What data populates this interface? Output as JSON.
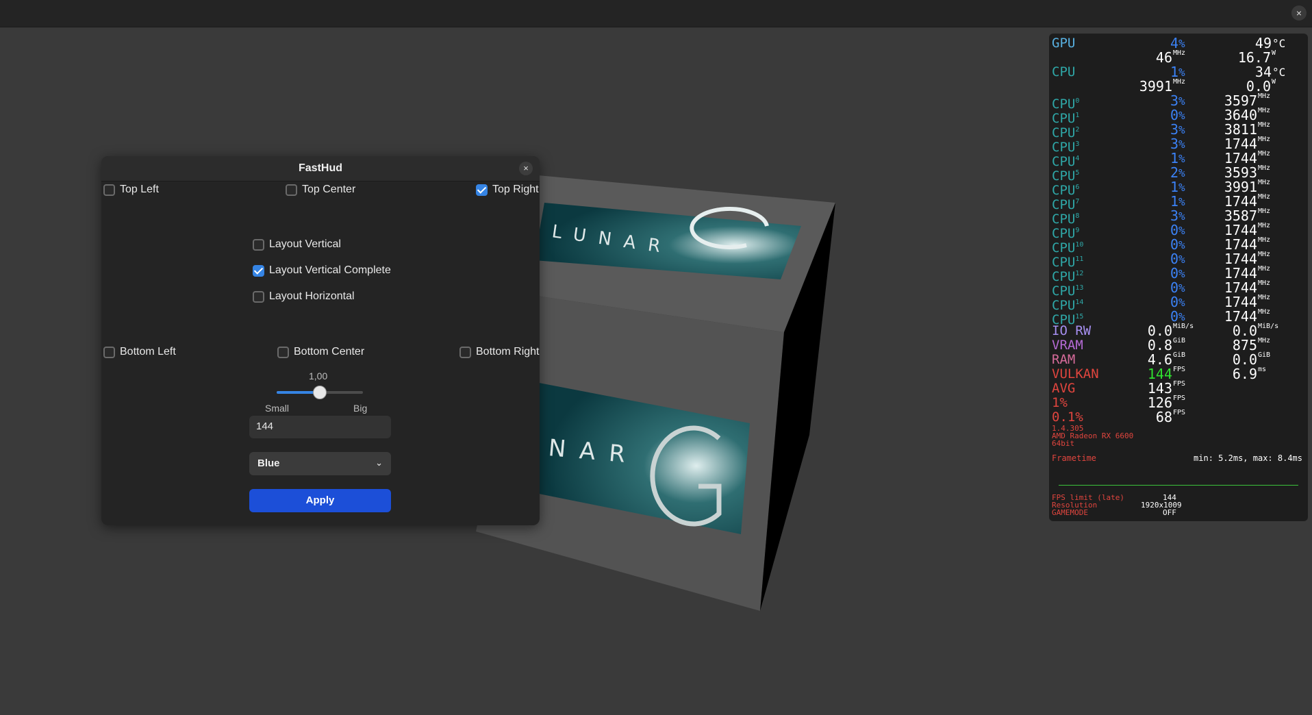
{
  "window": {
    "close_icon": "×"
  },
  "dialog": {
    "title": "FastHud",
    "close_icon": "×",
    "positions": {
      "top_left": {
        "label": "Top Left",
        "checked": false
      },
      "top_center": {
        "label": "Top Center",
        "checked": false
      },
      "top_right": {
        "label": "Top Right",
        "checked": true
      },
      "bottom_left": {
        "label": "Bottom Left",
        "checked": false
      },
      "bottom_center": {
        "label": "Bottom Center",
        "checked": false
      },
      "bottom_right": {
        "label": "Bottom Right",
        "checked": false
      }
    },
    "layouts": {
      "vertical": {
        "label": "Layout Vertical",
        "checked": false
      },
      "vertical_complete": {
        "label": "Layout Vertical Complete",
        "checked": true
      },
      "horizontal": {
        "label": "Layout Horizontal",
        "checked": false
      }
    },
    "scale": {
      "value_text": "1,00",
      "min_label": "Small",
      "max_label": "Big",
      "fraction": 0.5
    },
    "fps_limit_value": "144",
    "color_select": {
      "value": "Blue",
      "chevron_icon": "chevron-down-icon"
    },
    "apply_label": "Apply"
  },
  "hud": {
    "colors": {
      "gpu": "#58b0e0",
      "cpu": "#2fa7a7",
      "load": "#3b82f6",
      "io": "#a68ff0",
      "vram": "#b46ad4",
      "ram": "#d66b9a",
      "vulkan": "#e0453e",
      "fps_green": "#2fe12f",
      "info": "#e0453e"
    },
    "gpu": {
      "label": "GPU",
      "load": "4",
      "load_unit": "%",
      "temp": "49",
      "temp_unit": "°C",
      "clock": "46",
      "clock_unit": "MHz",
      "power": "16.7",
      "power_unit": "W"
    },
    "cpu": {
      "label": "CPU",
      "load": "1",
      "load_unit": "%",
      "temp": "34",
      "temp_unit": "°C",
      "clock": "3991",
      "clock_unit": "MHz",
      "power": "0.0",
      "power_unit": "W"
    },
    "cores": [
      {
        "idx": "0",
        "load": "3",
        "freq": "3597"
      },
      {
        "idx": "1",
        "load": "0",
        "freq": "3640"
      },
      {
        "idx": "2",
        "load": "3",
        "freq": "3811"
      },
      {
        "idx": "3",
        "load": "3",
        "freq": "1744"
      },
      {
        "idx": "4",
        "load": "1",
        "freq": "1744"
      },
      {
        "idx": "5",
        "load": "2",
        "freq": "3593"
      },
      {
        "idx": "6",
        "load": "1",
        "freq": "3991"
      },
      {
        "idx": "7",
        "load": "1",
        "freq": "1744"
      },
      {
        "idx": "8",
        "load": "3",
        "freq": "3587"
      },
      {
        "idx": "9",
        "load": "0",
        "freq": "1744"
      },
      {
        "idx": "10",
        "load": "0",
        "freq": "1744"
      },
      {
        "idx": "11",
        "load": "0",
        "freq": "1744"
      },
      {
        "idx": "12",
        "load": "0",
        "freq": "1744"
      },
      {
        "idx": "13",
        "load": "0",
        "freq": "1744"
      },
      {
        "idx": "14",
        "load": "0",
        "freq": "1744"
      },
      {
        "idx": "15",
        "load": "0",
        "freq": "1744"
      }
    ],
    "core_label": "CPU",
    "core_load_unit": "%",
    "core_freq_unit": "MHz",
    "io": {
      "label": "IO RW",
      "read": "0.0",
      "read_unit": "MiB/s",
      "write": "0.0",
      "write_unit": "MiB/s"
    },
    "vram": {
      "label": "VRAM",
      "used": "0.8",
      "used_unit": "GiB",
      "clock": "875",
      "clock_unit": "MHz"
    },
    "ram": {
      "label": "RAM",
      "used": "4.6",
      "used_unit": "GiB",
      "swap": "0.0",
      "swap_unit": "GiB"
    },
    "vulkan": {
      "label": "VULKAN",
      "fps": "144",
      "fps_unit": "FPS",
      "frametime": "6.9",
      "frametime_unit": "ms"
    },
    "avg": {
      "label": "AVG",
      "fps": "143",
      "fps_unit": "FPS"
    },
    "low1": {
      "label": "1%",
      "fps": "126",
      "fps_unit": "FPS"
    },
    "low01": {
      "label": "0.1%",
      "fps": "68",
      "fps_unit": "FPS"
    },
    "version": "1.4.305",
    "gpu_name": "AMD Radeon RX 6600",
    "arch": "64bit",
    "frametime_label": "Frametime",
    "frametime_range": "min: 5.2ms, max: 8.4ms",
    "fps_limit_label": "FPS limit (late)",
    "fps_limit_value": "144",
    "resolution_label": "Resolution",
    "resolution_value": "1920x1009",
    "gamemode_label": "GAMEMODE",
    "gamemode_value": "OFF"
  }
}
